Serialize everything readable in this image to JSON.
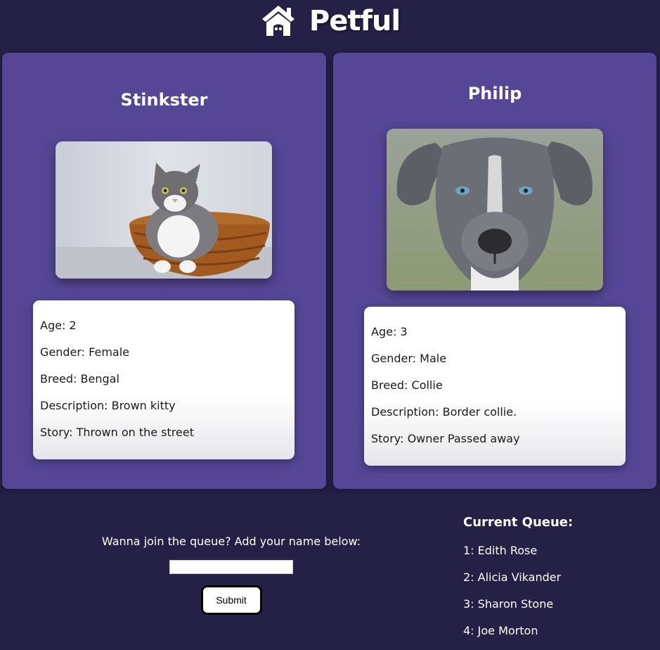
{
  "app": {
    "title": "Petful"
  },
  "pets": [
    {
      "name": "Stinkster",
      "image": "cat-photo",
      "details": {
        "age": "Age: 2",
        "gender": "Gender: Female",
        "breed": "Breed: Bengal",
        "description": "Description: Brown kitty",
        "story": "Story: Thrown on the street"
      }
    },
    {
      "name": "Philip",
      "image": "dog-photo",
      "details": {
        "age": "Age: 3",
        "gender": "Gender: Male",
        "breed": "Breed: Collie",
        "description": "Description: Border collie.",
        "story": "Story: Owner Passed away"
      }
    }
  ],
  "join": {
    "label": "Wanna join the queue? Add your name below:",
    "input_value": "",
    "input_placeholder": "",
    "submit_label": "Submit"
  },
  "queue": {
    "title": "Current Queue:",
    "items": [
      "1: Edith Rose",
      "2: Alicia Vikander",
      "3: Sharon Stone",
      "4: Joe Morton"
    ]
  },
  "colors": {
    "background": "#252046",
    "card": "#554796",
    "text": "#ffffff"
  },
  "icons": {
    "logo": "house-icon"
  }
}
